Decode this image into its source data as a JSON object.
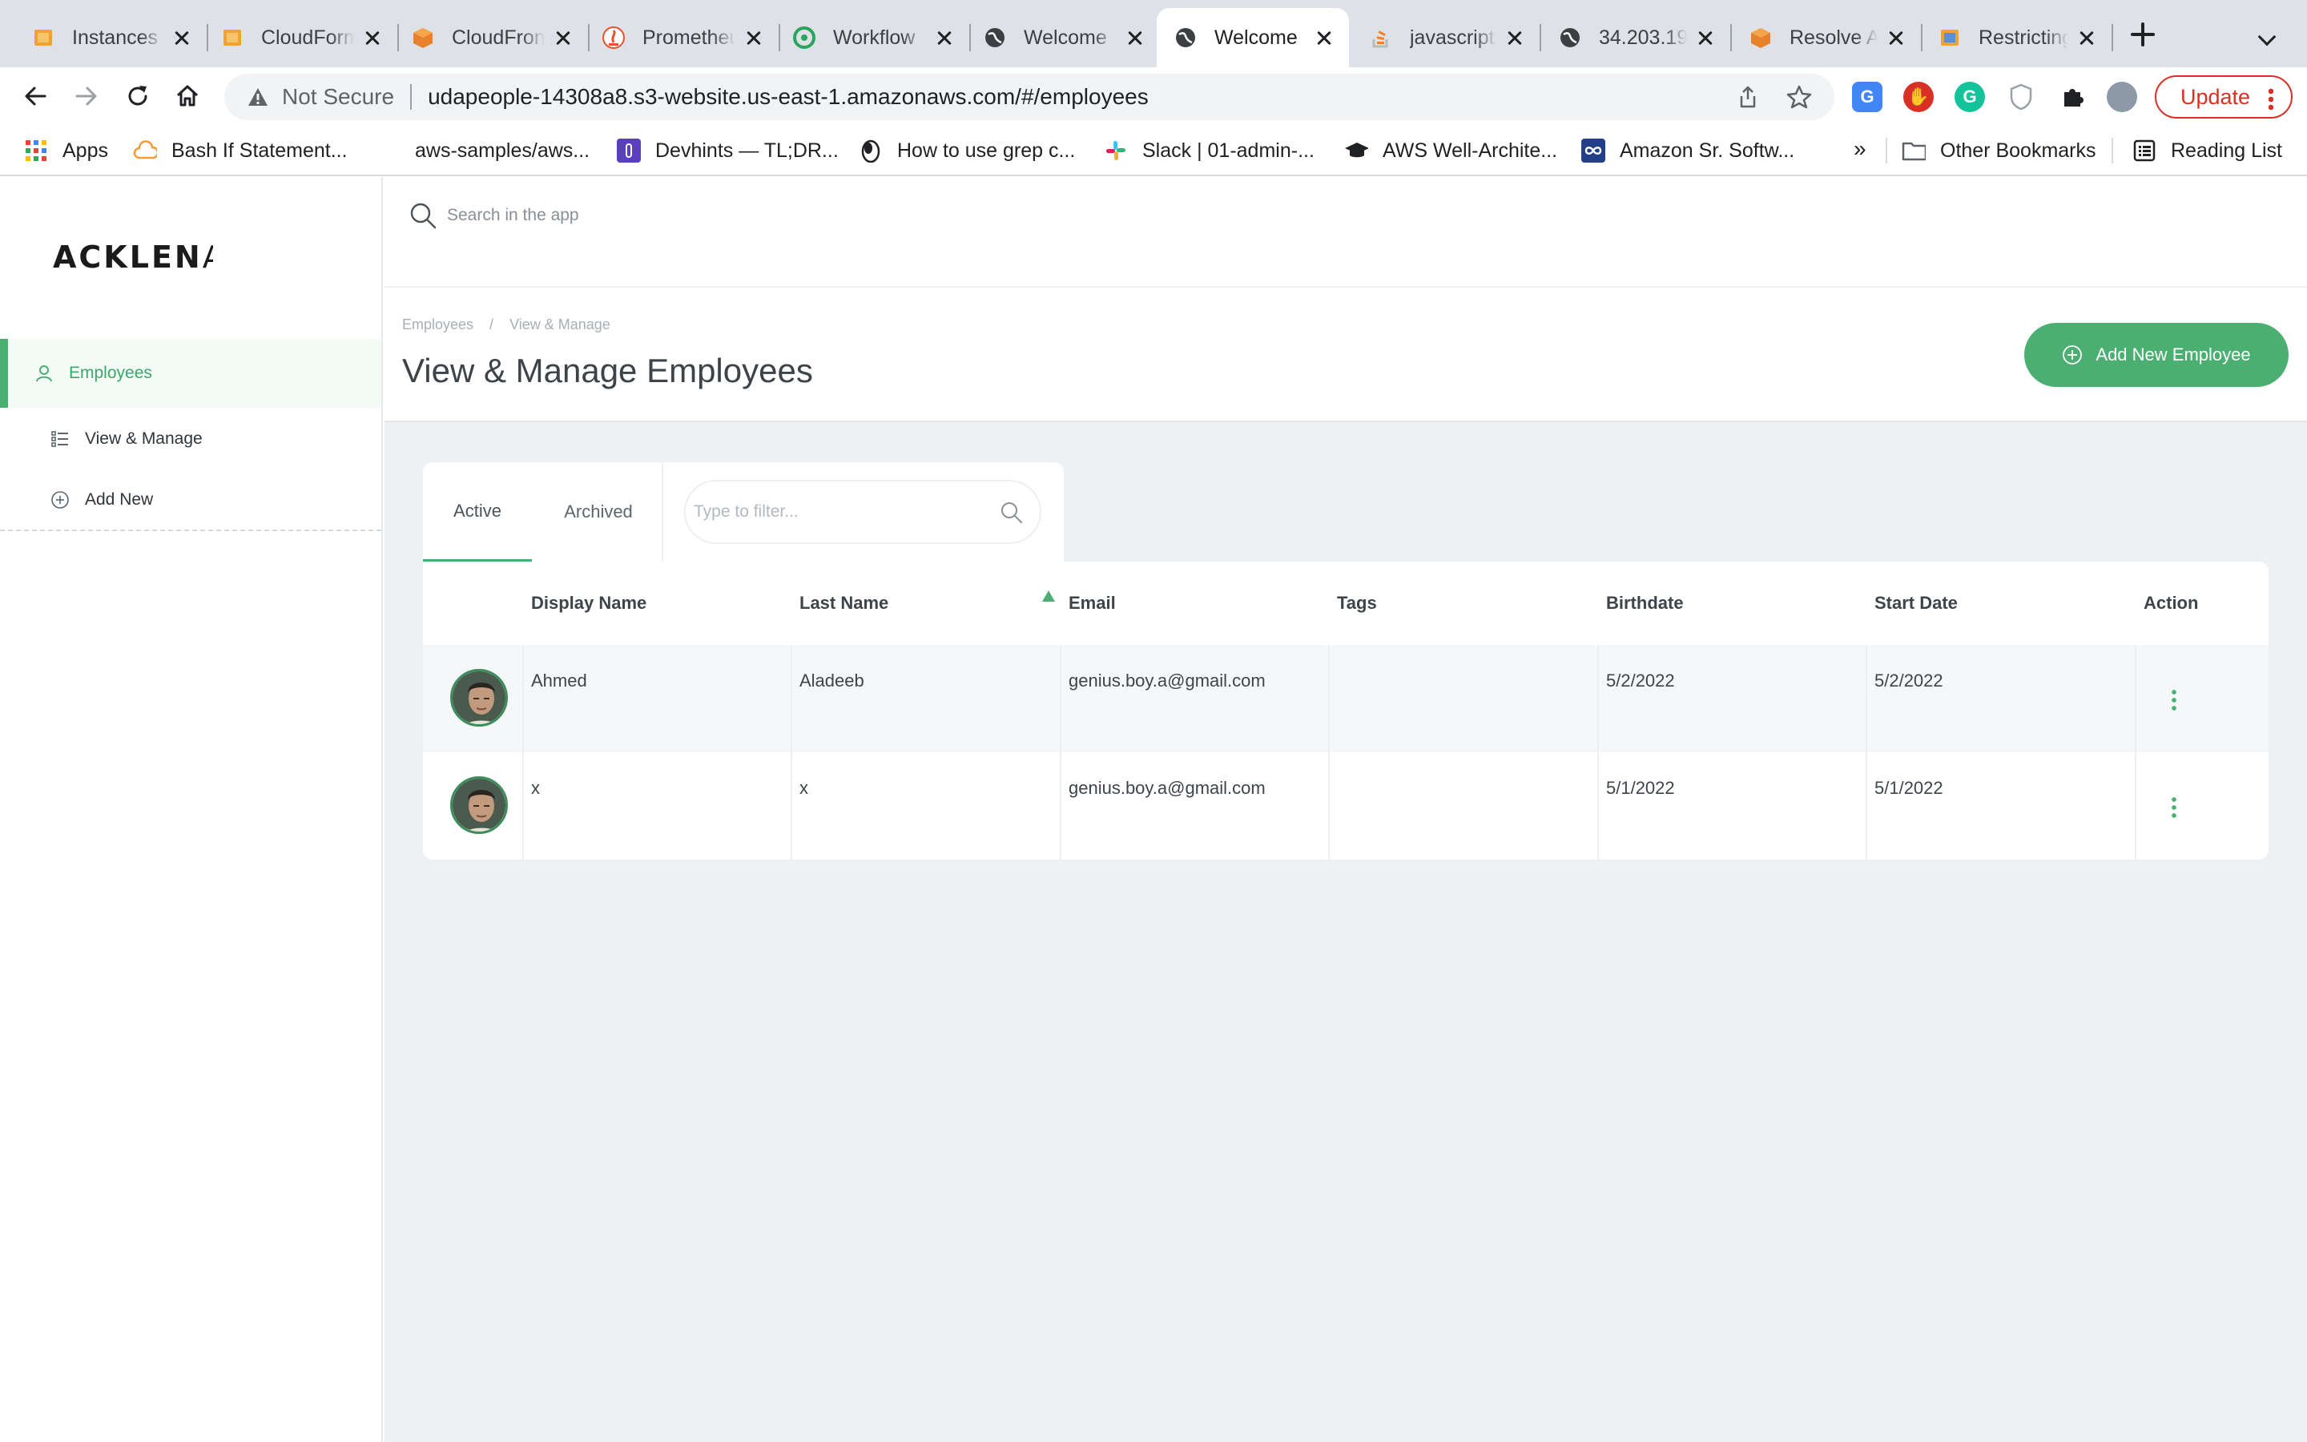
{
  "browser": {
    "tabs": [
      {
        "title": "Instances",
        "icon": "aws-ec2-icon",
        "active": false
      },
      {
        "title": "CloudFormation",
        "icon": "aws-cloudformation-icon",
        "active": false
      },
      {
        "title": "CloudFront",
        "icon": "aws-cloudfront-icon",
        "active": false
      },
      {
        "title": "Prometheus",
        "icon": "prometheus-icon",
        "active": false
      },
      {
        "title": "Workflow",
        "icon": "circleci-icon",
        "active": false
      },
      {
        "title": "Welcome",
        "icon": "globe-icon",
        "active": false
      },
      {
        "title": "Welcome",
        "icon": "globe-icon",
        "active": true
      },
      {
        "title": "javascript",
        "icon": "stackoverflow-icon",
        "active": false
      },
      {
        "title": "34.203.19",
        "icon": "globe-icon",
        "active": false
      },
      {
        "title": "Resolve A",
        "icon": "aws-icon",
        "active": false
      },
      {
        "title": "Restricting",
        "icon": "aws-s3-icon",
        "active": false
      }
    ],
    "address": {
      "security_label": "Not Secure",
      "url": "udapeople-14308a8.s3-website.us-east-1.amazonaws.com/#/employees"
    },
    "update_label": "Update",
    "bookmarks": [
      {
        "label": "Apps",
        "icon": "apps-grid-icon"
      },
      {
        "label": "Bash If Statement...",
        "icon": "cloud-icon"
      },
      {
        "label": "aws-samples/aws...",
        "icon": "blank-icon"
      },
      {
        "label": "Devhints — TL;DR...",
        "icon": "devhints-icon"
      },
      {
        "label": "How to use grep c...",
        "icon": "linux-icon"
      },
      {
        "label": "Slack | 01-admin-...",
        "icon": "slack-icon"
      },
      {
        "label": "AWS Well-Archite...",
        "icon": "graduation-cap-icon"
      },
      {
        "label": "Amazon Sr. Softw...",
        "icon": "infinity-icon"
      }
    ],
    "bookmarks_more": "»",
    "other_bookmarks": "Other Bookmarks",
    "reading_list": "Reading List"
  },
  "app": {
    "logo_bold": "ACKLEN",
    "logo_light": "AV",
    "search_placeholder": "Search in the app",
    "sidebar": {
      "section": "Employees",
      "items": [
        "View & Manage",
        "Add New"
      ]
    },
    "breadcrumb": [
      "Employees",
      "View & Manage"
    ],
    "breadcrumb_separator": "/",
    "page_title": "View & Manage Employees",
    "add_button": "Add New Employee",
    "filter_tabs": [
      "Active",
      "Archived"
    ],
    "filter_placeholder": "Type to filter...",
    "table": {
      "columns": [
        "Display Name",
        "Last Name",
        "Email",
        "Tags",
        "Birthdate",
        "Start Date",
        "Action"
      ],
      "sorted_by": "Last Name",
      "rows": [
        {
          "display_name": "Ahmed",
          "last_name": "Aladeeb",
          "email": "genius.boy.a@gmail.com",
          "tags": "",
          "birthdate": "5/2/2022",
          "start_date": "5/2/2022"
        },
        {
          "display_name": "x",
          "last_name": "x",
          "email": "genius.boy.a@gmail.com",
          "tags": "",
          "birthdate": "5/1/2022",
          "start_date": "5/1/2022"
        }
      ]
    }
  },
  "colors": {
    "accent": "#4caf72",
    "update_red": "#d93025",
    "content_bg": "#eef1f3"
  }
}
